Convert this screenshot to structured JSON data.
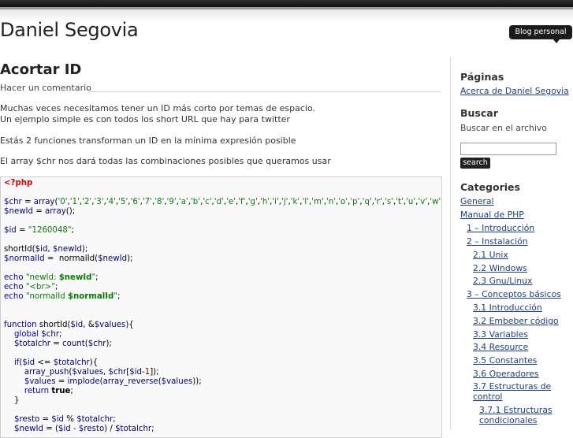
{
  "header": {
    "site_title": "Daniel Segovia",
    "tagline": "Blog personal"
  },
  "post": {
    "title": "Acortar ID",
    "comment_link": "Hacer un comentario",
    "paragraphs": [
      "Muchas veces necesitamos tener un ID más corto por temas de espacio.",
      "Un ejemplo simple es con todos los short URL que hay para twitter",
      "Estás 2 funciones transforman un ID en la mínima expresión posible",
      "El array $chr nos dará todas las combinaciones posibles que queramos usar"
    ]
  },
  "sidebar": {
    "pages_heading": "Páginas",
    "pages": [
      "Acerca de Daniel Segovia"
    ],
    "search_heading": "Buscar",
    "search_label": "Buscar en el archivo",
    "search_button": "search",
    "categories_heading": "Categories",
    "categories": [
      "General",
      "Manual de PHP",
      "1 – Introducción",
      "2 – Instalación",
      "2.1 Unix",
      "2.2 Windows",
      "2.3 Gnu/Linux",
      "3 – Conceptos básicos",
      "3.1 Introducción",
      "3.2 Embeber código",
      "3.3 Variables",
      "3.4 Resource",
      "3.5 Constantes",
      "3.6 Operadores",
      "3.7 Estructuras de",
      "control",
      "3.7.1 Estructuras",
      "condicionales"
    ]
  },
  "colors": {
    "link": "#1a3d8f",
    "top_bar": "#111111",
    "php_tag": "#dd0000",
    "string": "#0a7a0a",
    "keyword": "#0000cc"
  }
}
